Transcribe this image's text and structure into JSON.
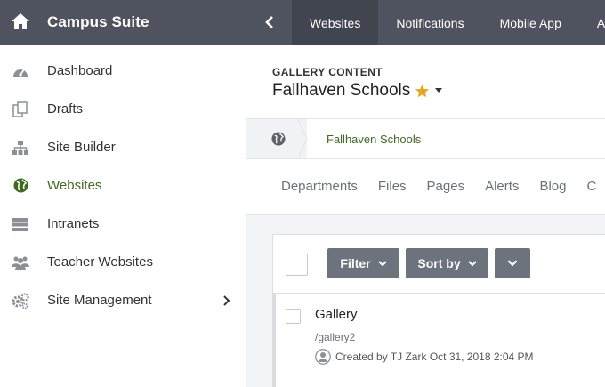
{
  "app": {
    "brand": "Campus Suite",
    "brand_bg": "#4f5360",
    "accent_green": "#3d6b1f"
  },
  "topnav": {
    "tabs": [
      {
        "label": "Websites",
        "active": true
      },
      {
        "label": "Notifications",
        "active": false
      },
      {
        "label": "Mobile App",
        "active": false
      },
      {
        "label": "Ac",
        "active": false
      }
    ]
  },
  "sidebar": {
    "items": [
      {
        "label": "Dashboard",
        "icon": "dashboard-icon"
      },
      {
        "label": "Drafts",
        "icon": "drafts-icon"
      },
      {
        "label": "Site Builder",
        "icon": "sitemap-icon"
      },
      {
        "label": "Websites",
        "icon": "globe-icon",
        "active": true
      },
      {
        "label": "Intranets",
        "icon": "server-icon"
      },
      {
        "label": "Teacher Websites",
        "icon": "users-icon"
      },
      {
        "label": "Site Management",
        "icon": "gears-icon",
        "has_submenu": true
      }
    ]
  },
  "header": {
    "section_label": "GALLERY CONTENT",
    "site_name": "Fallhaven Schools"
  },
  "breadcrumb": {
    "current": "Fallhaven Schools"
  },
  "subnav": {
    "items": [
      "Departments",
      "Files",
      "Pages",
      "Alerts",
      "Blog",
      "C"
    ]
  },
  "toolbar": {
    "filter_label": "Filter",
    "sort_label": "Sort by"
  },
  "list": {
    "items": [
      {
        "title": "Gallery",
        "path": "/gallery2",
        "meta": "Created by TJ Zark Oct 31, 2018 2:04 PM"
      }
    ]
  }
}
